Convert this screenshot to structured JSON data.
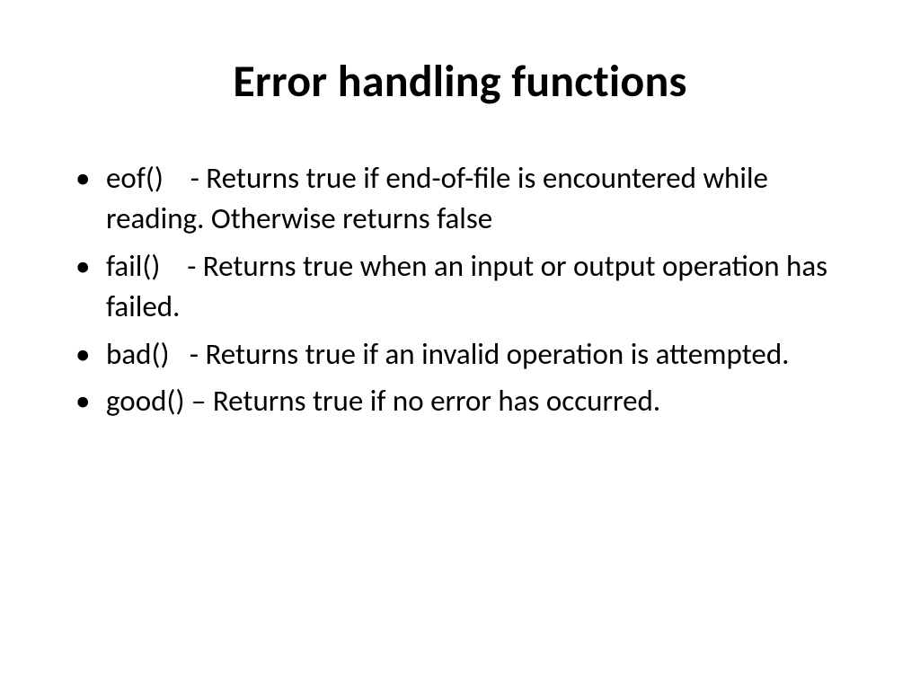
{
  "slide": {
    "title": "Error handling functions",
    "bullets": [
      "eof()    - Returns true if end-of-file is encountered while reading. Otherwise returns false",
      "fail()    - Returns true when an input or output operation has failed.",
      "bad()   - Returns true if an invalid operation is attempted.",
      "good() – Returns true if no error has occurred."
    ]
  }
}
